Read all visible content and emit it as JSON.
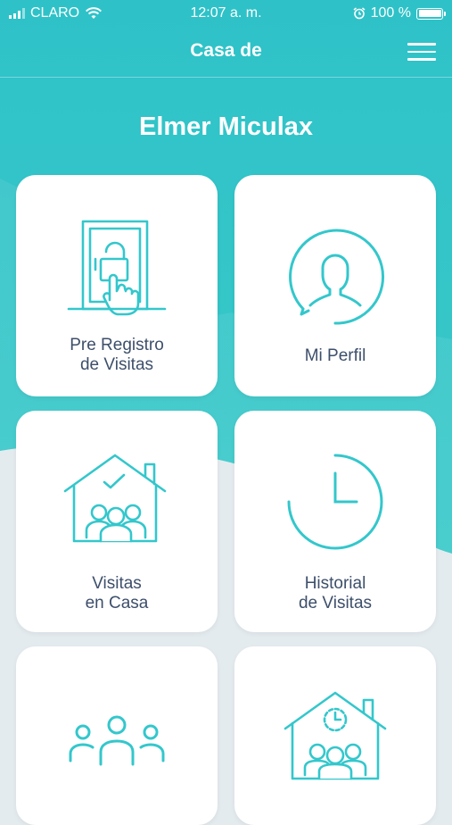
{
  "status": {
    "carrier": "CLARO",
    "time": "12:07 a. m.",
    "battery": "100 %"
  },
  "header": {
    "title": "Casa de"
  },
  "user": {
    "name": "Elmer Miculax"
  },
  "cards": [
    {
      "line1": "Pre Registro",
      "line2": "de Visitas",
      "icon": "door-lock-tap-icon"
    },
    {
      "line1": "Mi Perfil",
      "line2": "",
      "icon": "profile-icon"
    },
    {
      "line1": "Visitas",
      "line2": "en Casa",
      "icon": "house-visitors-icon"
    },
    {
      "line1": "Historial",
      "line2": "de Visitas",
      "icon": "clock-history-icon"
    },
    {
      "line1": "",
      "line2": "",
      "icon": "people-group-icon"
    },
    {
      "line1": "",
      "line2": "",
      "icon": "house-clock-icon"
    }
  ],
  "colors": {
    "accent": "#33c7cc",
    "header": "#2ec2c8",
    "label": "#3d4f6b",
    "background": "#e4ebef"
  }
}
